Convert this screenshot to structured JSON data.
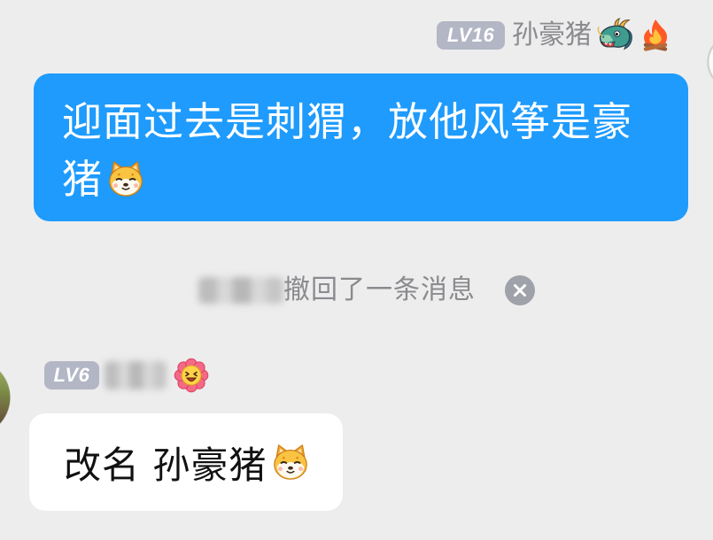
{
  "outgoing_message": {
    "sender": {
      "level_badge": "LV16",
      "name": "孙豪猪",
      "title_icons": [
        "dragon-icon",
        "fire-icon"
      ]
    },
    "text": "迎面过去是刺猬，放他风筝是豪猪",
    "emoji": "dog-emoji-icon"
  },
  "system_notice": {
    "text": "撤回了一条消息",
    "dismiss_icon": "close-icon"
  },
  "incoming_message": {
    "sender": {
      "level_badge": "LV6",
      "status_icon": "flower-emoji-icon"
    },
    "text": "改名 孙豪猪",
    "emoji": "dog-emoji-icon"
  },
  "colors": {
    "background": "#ededed",
    "outgoing_bubble": "#1e9bfd",
    "outgoing_text": "#ffffff",
    "incoming_bubble": "#ffffff",
    "incoming_text": "#111111",
    "level_badge": "#b3b6c4",
    "meta_text": "#8a8a8f",
    "notice_icon": "#a0a2aa"
  }
}
